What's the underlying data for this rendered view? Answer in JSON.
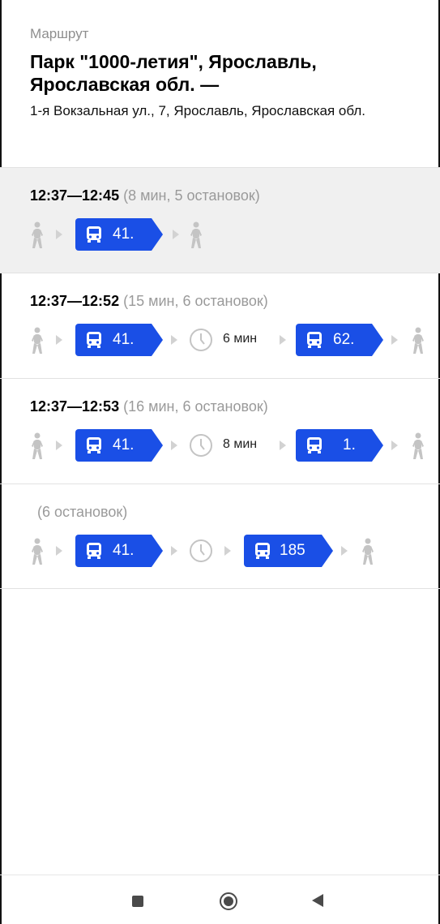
{
  "header": {
    "caption": "Маршрут",
    "title": "Парк \"1000-летия\", Ярославль, Ярославская обл. —",
    "address": "1-я Вокзальная ул., 7, Ярославль, Ярославская обл."
  },
  "routes": [
    {
      "time": "12:37—12:45",
      "details": " (8 мин, 5 остановок)"
    },
    {
      "time": "12:37—12:52",
      "details": " (15 мин, 6 остановок)",
      "wait": "6 мин"
    },
    {
      "time": "12:37—12:53",
      "details": " (16 мин, 6 остановок)",
      "wait": "8 мин"
    },
    {
      "time": "",
      "details": "(6 остановок)"
    }
  ],
  "buses": [
    [
      "41."
    ],
    [
      "41.",
      "62."
    ],
    [
      "41.",
      "1."
    ],
    [
      "41.",
      "185"
    ]
  ],
  "colors": {
    "bus_badge": "#1a4fe6",
    "selected_row_bg": "#f0f0f0",
    "muted_text": "#9a9a9a",
    "walk_icon": "#c4c4c4"
  },
  "icons": [
    "walk-icon",
    "bus-icon",
    "clock-icon",
    "chevron-right-icon",
    "recents-icon",
    "home-icon",
    "back-icon"
  ]
}
